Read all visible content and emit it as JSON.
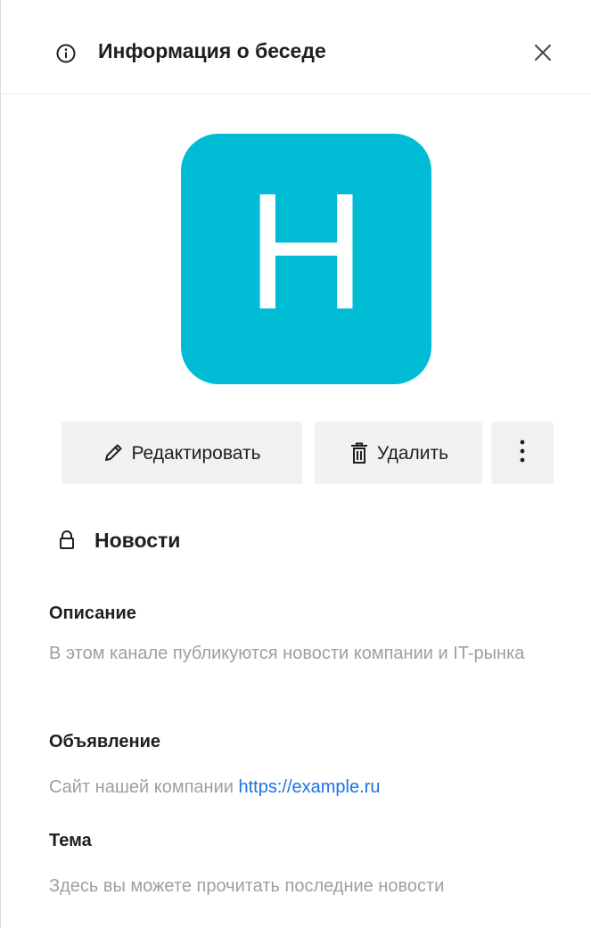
{
  "header": {
    "title": "Информация о беседе",
    "icon": "info-icon",
    "close_icon": "close-icon"
  },
  "avatar": {
    "letter": "Н",
    "background_color": "#00BCD4"
  },
  "actions": {
    "edit_label": "Редактировать",
    "edit_icon": "pencil-icon",
    "delete_label": "Удалить",
    "delete_icon": "trash-icon",
    "more_icon": "more-vertical-icon"
  },
  "channel": {
    "name": "Новости",
    "icon": "lock-icon"
  },
  "sections": {
    "description": {
      "title": "Описание",
      "text": "В этом канале публикуются новости компании и IT-рынка"
    },
    "announcement": {
      "title": "Объявление",
      "text": "Сайт нашей компании ",
      "link": "https://example.ru"
    },
    "topic": {
      "title": "Тема",
      "text": "Здесь вы можете прочитать последние новости"
    }
  }
}
